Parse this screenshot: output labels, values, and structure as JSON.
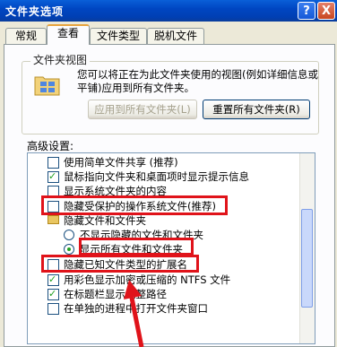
{
  "window": {
    "title": "文件夹选项",
    "help_label": "?",
    "close_label": "X"
  },
  "tabs": [
    "常规",
    "查看",
    "文件类型",
    "脱机文件"
  ],
  "folder_view": {
    "title": "文件夹视图",
    "description": "您可以将正在为此文件夹使用的视图(例如详细信息或平铺)应用到所有文件夹。",
    "apply_button": "应用到所有文件夹(L)",
    "reset_button": "重置所有文件夹(R)"
  },
  "advanced": {
    "label": "高级设置:",
    "items": [
      "使用简单文件共享 (推荐)",
      "鼠标指向文件夹和桌面项时显示提示信息",
      "显示系统文件夹的内容",
      "隐藏受保护的操作系统文件(推荐)",
      "隐藏文件和文件夹",
      "不显示隐藏的文件和文件夹",
      "显示所有文件和文件夹",
      "隐藏已知文件类型的扩展名",
      "用彩色显示加密或压缩的 NTFS 文件",
      "在标题栏显示完整路径",
      "在单独的进程中打开文件夹窗口"
    ]
  },
  "colors": {
    "highlight": "#e0131a",
    "titlebar": "#0046c2",
    "active_tab": "#e7a33e"
  }
}
